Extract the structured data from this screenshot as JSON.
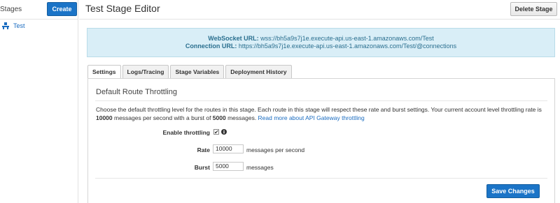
{
  "sidebar": {
    "title": "Stages",
    "create_label": "Create",
    "items": [
      {
        "label": "Test",
        "icon": "stage-icon"
      }
    ]
  },
  "header": {
    "title": "Test Stage Editor",
    "delete_label": "Delete Stage"
  },
  "info": {
    "websocket_label": "WebSocket URL:",
    "websocket_value": "wss://bh5a9s7j1e.execute-api.us-east-1.amazonaws.com/Test",
    "connection_label": "Connection URL:",
    "connection_value": "https://bh5a9s7j1e.execute-api.us-east-1.amazonaws.com/Test/@connections"
  },
  "tabs": [
    {
      "label": "Settings",
      "active": true
    },
    {
      "label": "Logs/Tracing"
    },
    {
      "label": "Stage Variables"
    },
    {
      "label": "Deployment History"
    }
  ],
  "settings": {
    "title": "Default Route Throttling",
    "desc_part1": "Choose the default throttling level for the routes in this stage. Each route in this stage will respect these rate and burst settings. Your current account level throttling rate is ",
    "desc_rate": "10000",
    "desc_part2": " messages per second with a burst of ",
    "desc_burst": "5000",
    "desc_part3": " messages. ",
    "desc_link": "Read more about API Gateway throttling",
    "enable_label": "Enable throttling",
    "enable_checked": "✔",
    "rate_label": "Rate",
    "rate_value": "10000",
    "rate_unit": "messages per second",
    "burst_label": "Burst",
    "burst_value": "5000",
    "burst_unit": "messages",
    "save_label": "Save Changes"
  },
  "colors": {
    "primary": "#1b74c7",
    "info_bg": "#d9eef7",
    "link": "#1a6cc0"
  }
}
